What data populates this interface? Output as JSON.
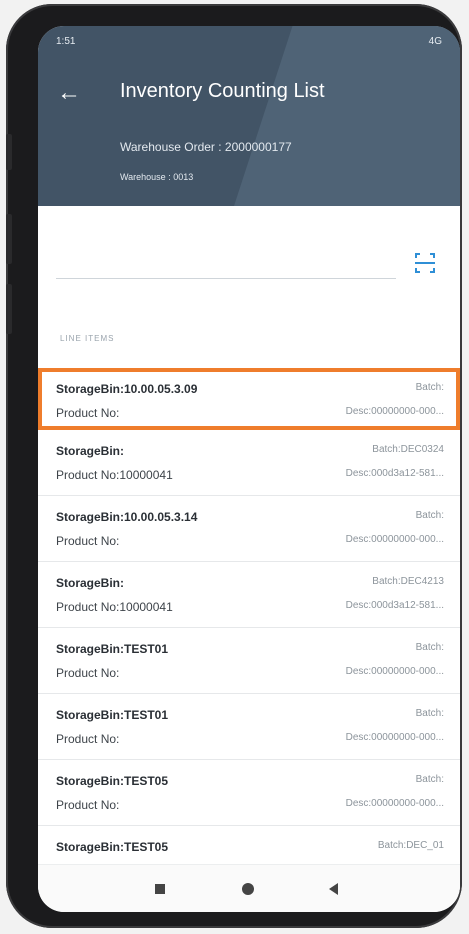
{
  "status_bar": {
    "time": "1:51",
    "indicators": "4G"
  },
  "header": {
    "title": "Inventory Counting List",
    "warehouse_order": "Warehouse Order : 2000000177",
    "warehouse": "Warehouse : 0013"
  },
  "section": {
    "label": "LINE ITEMS"
  },
  "items": [
    {
      "bin": "StorageBin:10.00.05.3.09",
      "product": "Product No:",
      "batch": "Batch:",
      "desc": "Desc:00000000-000..."
    },
    {
      "bin": "StorageBin:",
      "product": "Product No:10000041",
      "batch": "Batch:DEC0324",
      "desc": "Desc:000d3a12-581..."
    },
    {
      "bin": "StorageBin:10.00.05.3.14",
      "product": "Product No:",
      "batch": "Batch:",
      "desc": "Desc:00000000-000..."
    },
    {
      "bin": "StorageBin:",
      "product": "Product No:10000041",
      "batch": "Batch:DEC4213",
      "desc": "Desc:000d3a12-581..."
    },
    {
      "bin": "StorageBin:TEST01",
      "product": "Product No:",
      "batch": "Batch:",
      "desc": "Desc:00000000-000..."
    },
    {
      "bin": "StorageBin:TEST01",
      "product": "Product No:",
      "batch": "Batch:",
      "desc": "Desc:00000000-000..."
    },
    {
      "bin": "StorageBin:TEST05",
      "product": "Product No:",
      "batch": "Batch:",
      "desc": "Desc:00000000-000..."
    },
    {
      "bin": "StorageBin:TEST05",
      "product": "",
      "batch": "Batch:DEC_01",
      "desc": ""
    }
  ],
  "colors": {
    "header": "#425466",
    "highlight": "#ef7d2c",
    "accent": "#2f8fd6"
  },
  "icons": {
    "back": "arrow-left-icon",
    "scan": "barcode-scan-icon"
  }
}
